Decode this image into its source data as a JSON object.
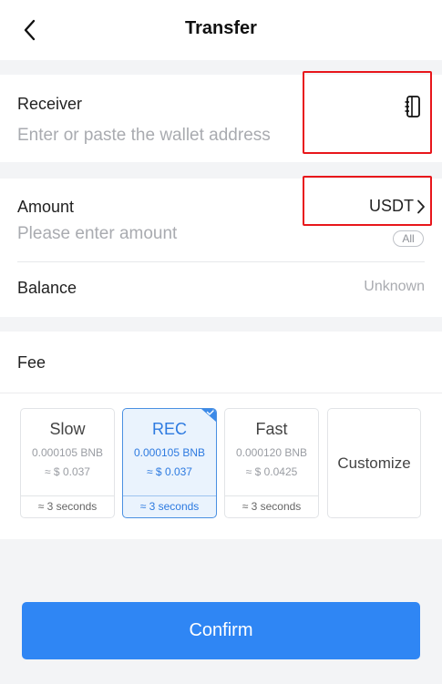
{
  "header": {
    "title": "Transfer"
  },
  "receiver": {
    "label": "Receiver",
    "placeholder": "Enter or paste the wallet address"
  },
  "amount": {
    "label": "Amount",
    "placeholder": "Please enter amount",
    "token": "USDT",
    "all_label": "All"
  },
  "balance": {
    "label": "Balance",
    "value": "Unknown"
  },
  "fee": {
    "label": "Fee",
    "options": [
      {
        "name": "Slow",
        "bnb": "0.000105 BNB",
        "usd": "≈ $ 0.037",
        "time": "≈ 3 seconds",
        "selected": false
      },
      {
        "name": "REC",
        "bnb": "0.000105 BNB",
        "usd": "≈ $ 0.037",
        "time": "≈ 3 seconds",
        "selected": true
      },
      {
        "name": "Fast",
        "bnb": "0.000120 BNB",
        "usd": "≈ $ 0.0425",
        "time": "≈ 3 seconds",
        "selected": false
      }
    ],
    "customize_label": "Customize"
  },
  "confirm_label": "Confirm",
  "colors": {
    "accent": "#2f86f4",
    "highlight": "#e8161b",
    "selected_fill": "#eaf3fd"
  }
}
